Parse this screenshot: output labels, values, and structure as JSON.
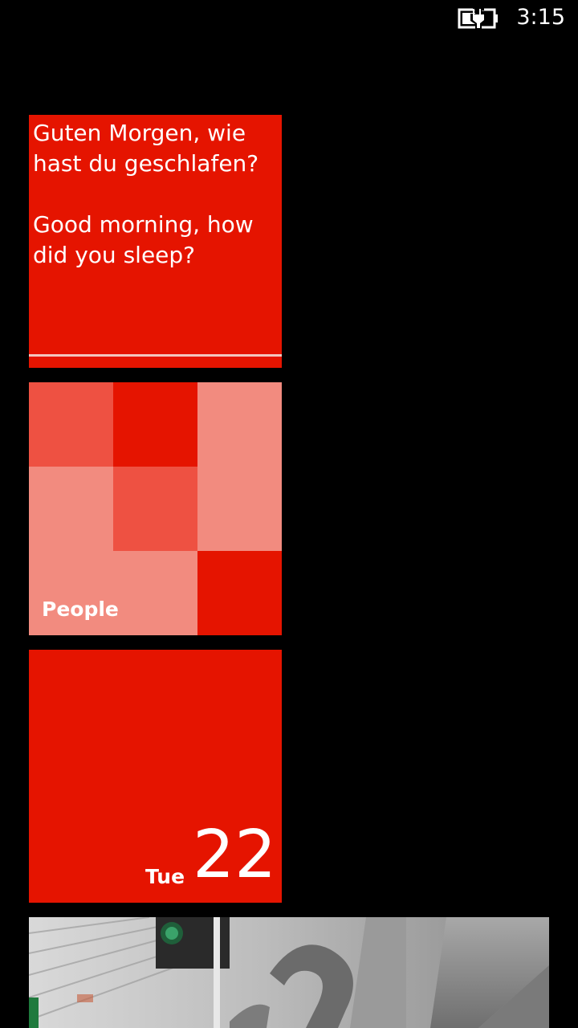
{
  "status_bar": {
    "time": "3:15",
    "battery_icon": "battery-charging-icon"
  },
  "tiles": {
    "phrase": {
      "german": "Guten Morgen, wie hast du geschlafen?",
      "english": "Good morning, how did you sleep?",
      "color": "#e51400"
    },
    "people": {
      "label": "People",
      "colors": [
        "#e51400",
        "#ee5142",
        "#f28b7f"
      ]
    },
    "calendar": {
      "day": "Tue",
      "date": "22",
      "color": "#e51400"
    },
    "photos": {
      "icon": "photo-icon"
    }
  }
}
